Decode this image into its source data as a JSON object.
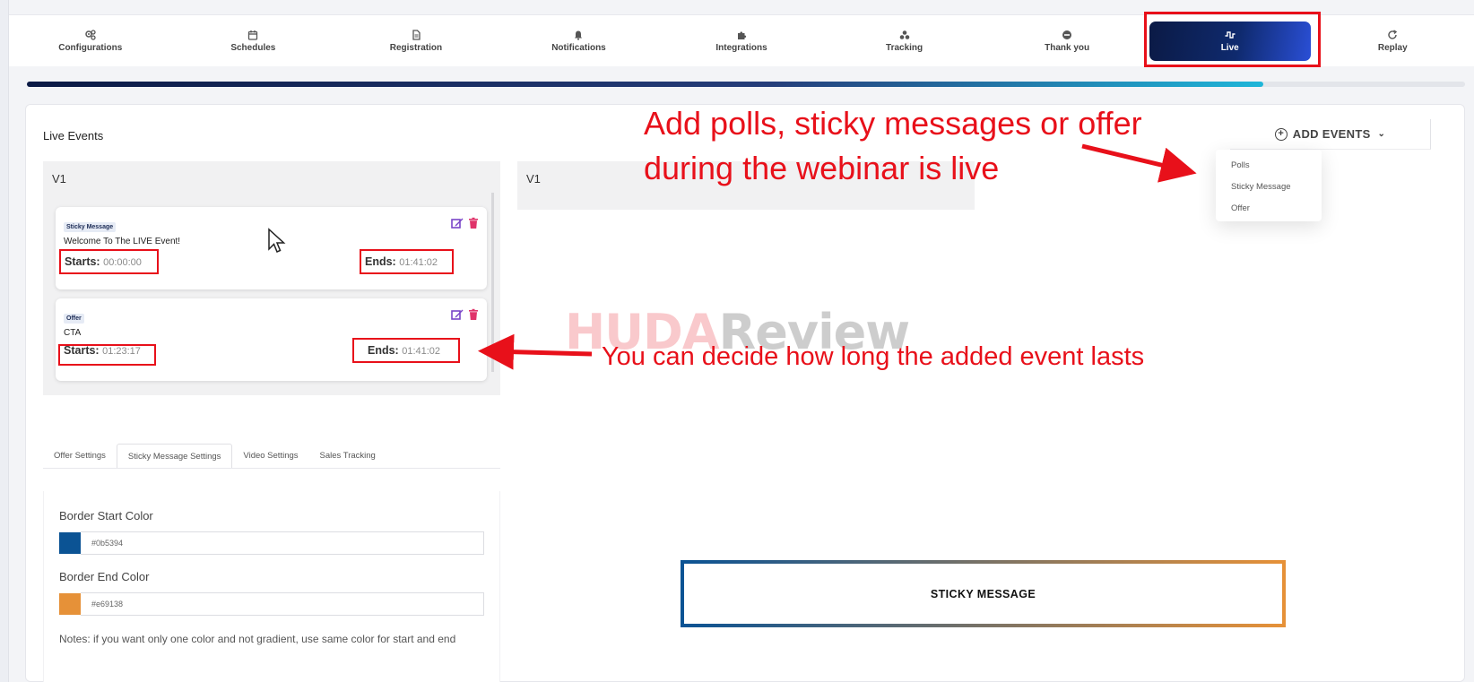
{
  "nav": {
    "tabs": [
      {
        "label": "Configurations",
        "icon": "gears-icon"
      },
      {
        "label": "Schedules",
        "icon": "calendar-icon"
      },
      {
        "label": "Registration",
        "icon": "document-icon"
      },
      {
        "label": "Notifications",
        "icon": "bell-icon"
      },
      {
        "label": "Integrations",
        "icon": "puzzle-icon"
      },
      {
        "label": "Tracking",
        "icon": "tracking-icon"
      },
      {
        "label": "Thank you",
        "icon": "smile-icon"
      },
      {
        "label": "Live",
        "icon": "pulse-icon",
        "active": true
      },
      {
        "label": "Replay",
        "icon": "refresh-icon"
      }
    ]
  },
  "progress": {
    "value": 0.86,
    "colors": [
      "#0b1a45",
      "#1fb6d9"
    ]
  },
  "live_events": {
    "title": "Live Events",
    "left_panel_label": "V1",
    "right_panel_label": "V1",
    "add_events_label": "ADD EVENTS",
    "dropdown_options": [
      "Polls",
      "Sticky Message",
      "Offer"
    ],
    "events": [
      {
        "type": "Sticky Message",
        "text": "Welcome To The LIVE Event!",
        "starts_label": "Starts:",
        "starts": "00:00:00",
        "ends_label": "Ends:",
        "ends": "01:41:02"
      },
      {
        "type": "Offer",
        "text": "CTA",
        "starts_label": "Starts:",
        "starts": "01:23:17",
        "ends_label": "Ends:",
        "ends": "01:41:02"
      }
    ]
  },
  "settings": {
    "tabs": [
      "Offer Settings",
      "Sticky Message Settings",
      "Video Settings",
      "Sales Tracking"
    ],
    "active_tab": "Sticky Message Settings",
    "border_start_label": "Border Start Color",
    "border_start_value": "#0b5394",
    "border_end_label": "Border End Color",
    "border_end_value": "#e69138",
    "notes": "Notes: if you want only one color and not gradient, use same color for start and end"
  },
  "preview": {
    "label": "STICKY MESSAGE"
  },
  "annotations": {
    "top_line1": "Add polls, sticky messages or offer",
    "top_line2": "during the webinar is live",
    "bottom": "You can decide how long the added event lasts",
    "watermark_part1": "HUDA",
    "watermark_part2": "Review",
    "annotation_color": "#e8101a"
  }
}
